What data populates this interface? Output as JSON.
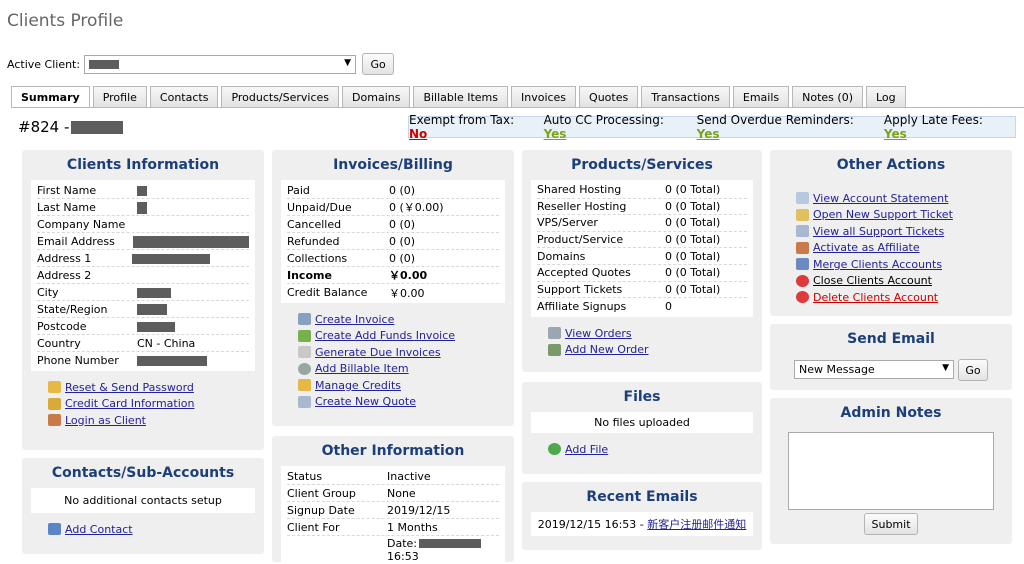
{
  "page_title": "Clients Profile",
  "active_client": {
    "label": "Active Client:",
    "go": "Go"
  },
  "tabs": [
    "Summary",
    "Profile",
    "Contacts",
    "Products/Services",
    "Domains",
    "Billable Items",
    "Invoices",
    "Quotes",
    "Transactions",
    "Emails",
    "Notes (0)",
    "Log"
  ],
  "client_id": "#824 -",
  "status_bar": {
    "tax_label": "Exempt from Tax:",
    "tax_value": "No",
    "cc_label": "Auto CC Processing:",
    "cc_value": "Yes",
    "overdue_label": "Send Overdue Reminders:",
    "overdue_value": "Yes",
    "late_label": "Apply Late Fees:",
    "late_value": "Yes"
  },
  "clients_info": {
    "title": "Clients Information",
    "rows": [
      {
        "label": "First Name",
        "value": ""
      },
      {
        "label": "Last Name",
        "value": ""
      },
      {
        "label": "Company Name",
        "value": ""
      },
      {
        "label": "Email Address",
        "value": ""
      },
      {
        "label": "Address 1",
        "value": ""
      },
      {
        "label": "Address 2",
        "value": ""
      },
      {
        "label": "City",
        "value": ""
      },
      {
        "label": "State/Region",
        "value": ""
      },
      {
        "label": "Postcode",
        "value": ""
      },
      {
        "label": "Country",
        "value": "CN - China"
      },
      {
        "label": "Phone Number",
        "value": ""
      }
    ],
    "links": [
      "Reset & Send Password",
      "Credit Card Information",
      "Login as Client"
    ]
  },
  "contacts": {
    "title": "Contacts/Sub-Accounts",
    "empty": "No additional contacts setup",
    "add": "Add Contact"
  },
  "invoices": {
    "title": "Invoices/Billing",
    "rows": [
      {
        "label": "Paid",
        "value": "0 (0)"
      },
      {
        "label": "Unpaid/Due",
        "value": "0 (￥0.00)"
      },
      {
        "label": "Cancelled",
        "value": "0 (0)"
      },
      {
        "label": "Refunded",
        "value": "0 (0)"
      },
      {
        "label": "Collections",
        "value": "0 (0)"
      },
      {
        "label": "Income",
        "value": "￥0.00"
      },
      {
        "label": "Credit Balance",
        "value": "￥0.00"
      }
    ],
    "links": [
      "Create Invoice",
      "Create Add Funds Invoice",
      "Generate Due Invoices",
      "Add Billable Item",
      "Manage Credits",
      "Create New Quote"
    ]
  },
  "other_info": {
    "title": "Other Information",
    "rows": [
      {
        "label": "Status",
        "value": "Inactive"
      },
      {
        "label": "Client Group",
        "value": "None"
      },
      {
        "label": "Signup Date",
        "value": "2019/12/15"
      },
      {
        "label": "Client For",
        "value": "1 Months"
      },
      {
        "label": "",
        "value": "Date:"
      },
      {
        "label": "",
        "value": "16:53"
      }
    ]
  },
  "products": {
    "title": "Products/Services",
    "rows": [
      {
        "label": "Shared Hosting",
        "value": "0 (0 Total)"
      },
      {
        "label": "Reseller Hosting",
        "value": "0 (0 Total)"
      },
      {
        "label": "VPS/Server",
        "value": "0 (0 Total)"
      },
      {
        "label": "Product/Service",
        "value": "0 (0 Total)"
      },
      {
        "label": "Domains",
        "value": "0 (0 Total)"
      },
      {
        "label": "Accepted Quotes",
        "value": "0 (0 Total)"
      },
      {
        "label": "Support Tickets",
        "value": "0 (0 Total)"
      },
      {
        "label": "Affiliate Signups",
        "value": "0"
      }
    ],
    "links": [
      "View Orders",
      "Add New Order"
    ]
  },
  "files": {
    "title": "Files",
    "empty": "No files uploaded",
    "add": "Add File"
  },
  "recent_emails": {
    "title": "Recent Emails",
    "item": "2019/12/15 16:53 -",
    "subject": "新客户注册邮件通知"
  },
  "other_actions": {
    "title": "Other Actions",
    "links": [
      "View Account Statement",
      "Open New Support Ticket",
      "View all Support Tickets",
      "Activate as Affiliate",
      "Merge Clients Accounts",
      "Close Clients Account",
      "Delete Clients Account"
    ]
  },
  "send_email": {
    "title": "Send Email",
    "selected": "New Message",
    "go": "Go"
  },
  "admin_notes": {
    "title": "Admin Notes",
    "submit": "Submit"
  }
}
